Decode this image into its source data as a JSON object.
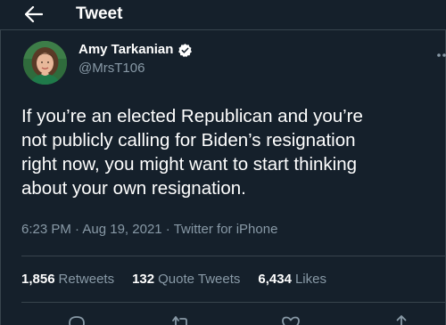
{
  "header": {
    "title": "Tweet"
  },
  "author": {
    "name": "Amy Tarkanian",
    "handle": "@MrsT106",
    "verified": true
  },
  "tweet": {
    "text": "If you’re an elected Republican and you’re\nnot publicly calling for Biden’s resignation\nright now, you might want to start thinking\nabout your own resignation.",
    "time": "6:23 PM",
    "separator": " · ",
    "date": "Aug 19, 2021",
    "source": "Twitter for iPhone"
  },
  "stats": {
    "retweets": {
      "count": "1,856",
      "label": "Retweets"
    },
    "quotes": {
      "count": "132",
      "label": "Quote Tweets"
    },
    "likes": {
      "count": "6,434",
      "label": "Likes"
    }
  },
  "icons": {
    "back": "arrow-left-icon",
    "verified": "verified-badge-icon",
    "more": "more-icon",
    "reply": "reply-icon",
    "retweet": "retweet-icon",
    "like": "heart-icon",
    "share": "share-icon"
  },
  "colors": {
    "background": "#15202b",
    "text": "#ffffff",
    "secondary_text": "#8899a6",
    "divider": "#38444d",
    "verified_badge": "#ffffff"
  }
}
